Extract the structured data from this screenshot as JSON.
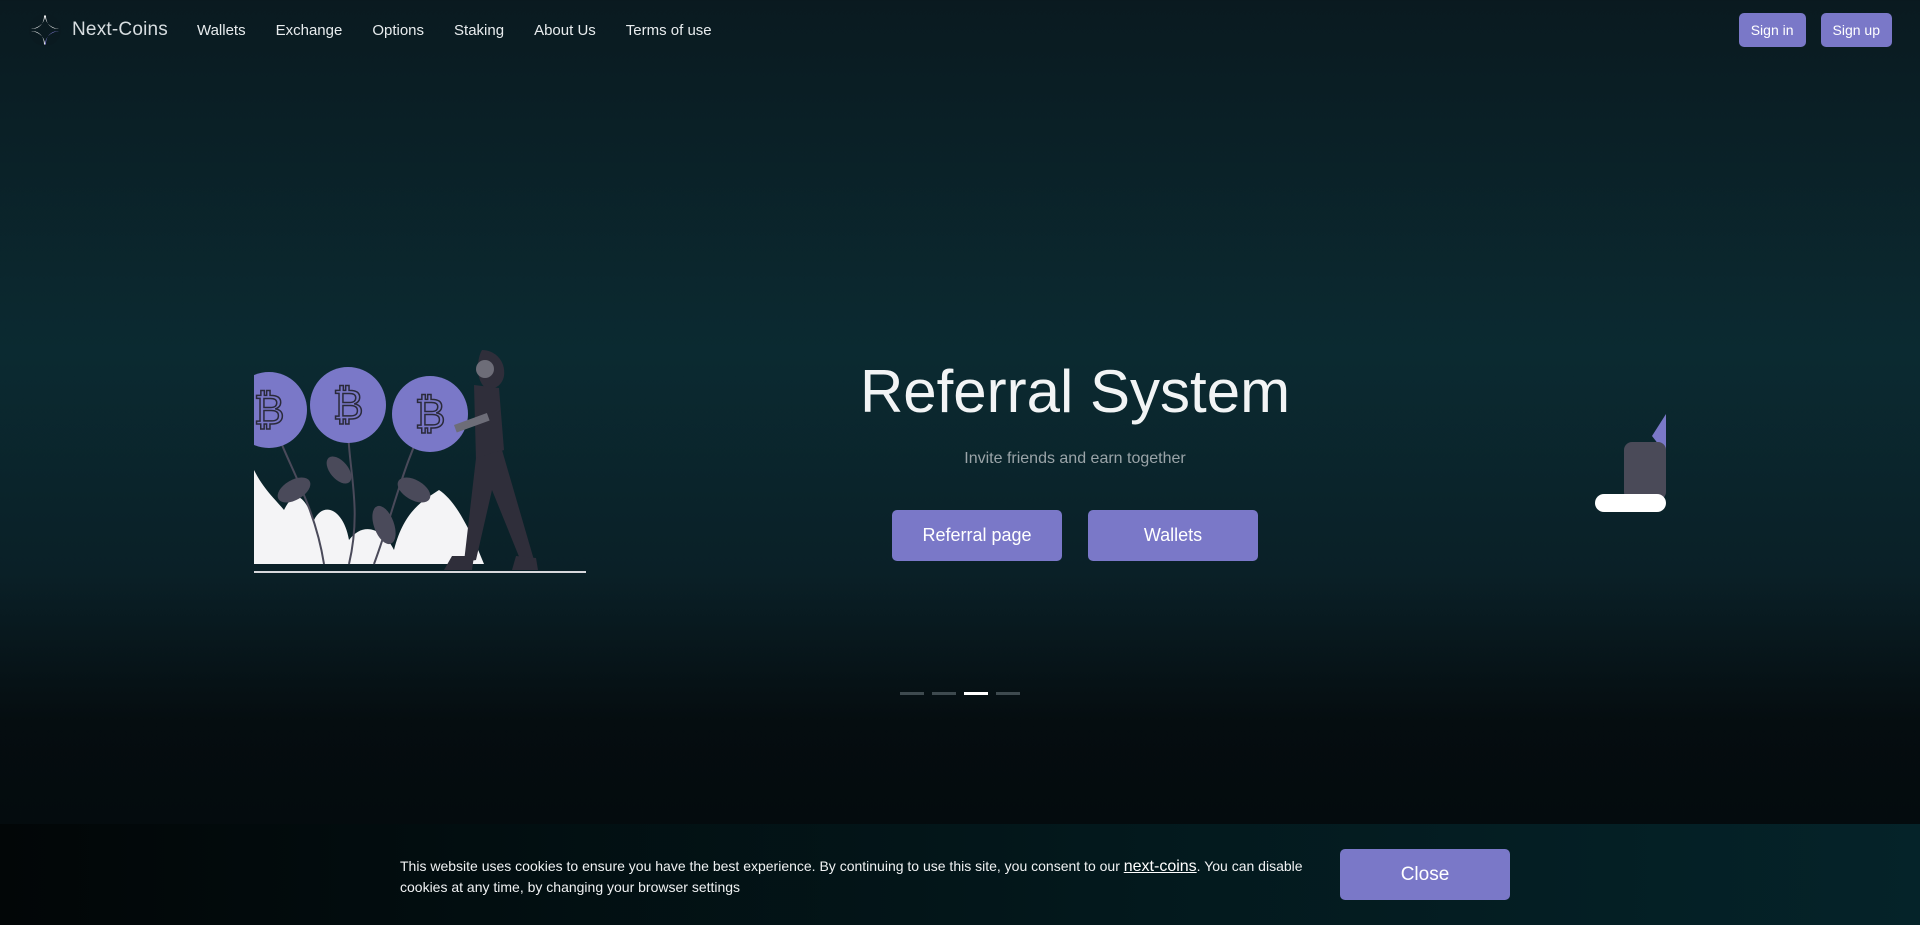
{
  "brand": {
    "name": "Next-Coins",
    "logo_icon": "next-coins-logo-icon"
  },
  "nav": {
    "links": [
      "Wallets",
      "Exchange",
      "Options",
      "Staking",
      "About Us",
      "Terms of use"
    ],
    "sign_in": "Sign in",
    "sign_up": "Sign up"
  },
  "hero": {
    "title": "Referral System",
    "subtitle": "Invite friends and earn together",
    "primary_button": "Referral page",
    "secondary_button": "Wallets",
    "illustration_icon": "bitcoin-plants-person-illustration",
    "slide_count": 4,
    "active_slide": 3
  },
  "cookie": {
    "text_before": "This website uses cookies to ensure you have the best experience. By continuing to use this site, you consent to our ",
    "link": "next-coins",
    "text_after": ". You can disable cookies at any time, by changing your browser settings",
    "close": "Close"
  },
  "colors": {
    "accent": "#7a78c8",
    "background_top": "#0a1a20",
    "background_mid": "#0b2a31"
  }
}
